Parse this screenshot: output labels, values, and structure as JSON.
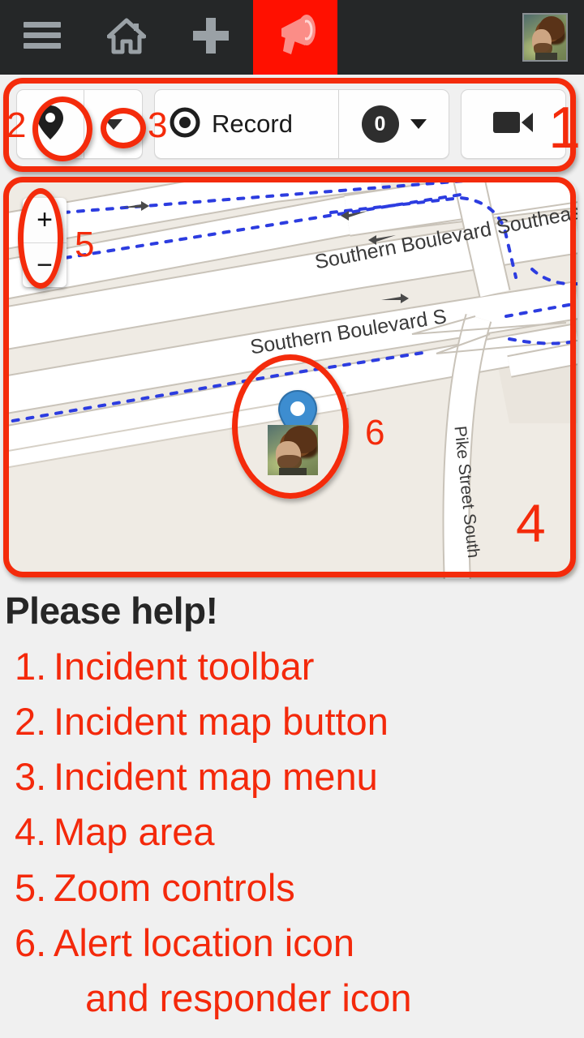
{
  "navbar": {
    "background": "#252728",
    "alert_background": "#FF1000",
    "items": [
      {
        "icon": "hamburger-menu-icon",
        "label": ""
      },
      {
        "icon": "home-icon",
        "label": ""
      },
      {
        "icon": "plus-icon",
        "label": ""
      },
      {
        "icon": "megaphone-alert-icon",
        "label": ""
      }
    ],
    "avatar_alt": "user-avatar"
  },
  "toolbar": {
    "map_button_icon": "map-pin-icon",
    "map_menu_icon": "chevron-down-icon",
    "record_label": "Record",
    "record_icon": "record-dot-icon",
    "counter_value": "0",
    "counter_caret_icon": "chevron-down-icon",
    "video_icon": "video-camera-icon"
  },
  "map": {
    "background_color": "#EFEBE4",
    "road_color": "#FFFFFF",
    "footpath_color": "#2C3CE0",
    "zoom_in_label": "+",
    "zoom_out_label": "−",
    "alert_pin_color": "#3C8DD0",
    "labels": [
      {
        "text": "Southern Boulevard Southeast",
        "id": "street-label-southern-blvd-se-upper"
      },
      {
        "text": "Southern Boulevard S",
        "id": "street-label-southern-blvd-se-lower"
      },
      {
        "text": "Pike Street South",
        "id": "street-label-pike-street-south"
      }
    ]
  },
  "annotations": {
    "color": "#F42B0B",
    "markers": [
      "1",
      "2",
      "3",
      "4",
      "5",
      "6"
    ]
  },
  "legend": {
    "title": "Please help!",
    "items": [
      {
        "num": "1.",
        "text": "Incident toolbar"
      },
      {
        "num": "2.",
        "text": "Incident map button"
      },
      {
        "num": "3.",
        "text": "Incident map menu"
      },
      {
        "num": "4.",
        "text": "Map area"
      },
      {
        "num": "5.",
        "text": "Zoom controls"
      },
      {
        "num": "6.",
        "text": "Alert location icon"
      },
      {
        "num": "",
        "text": "   and responder icon"
      }
    ]
  }
}
